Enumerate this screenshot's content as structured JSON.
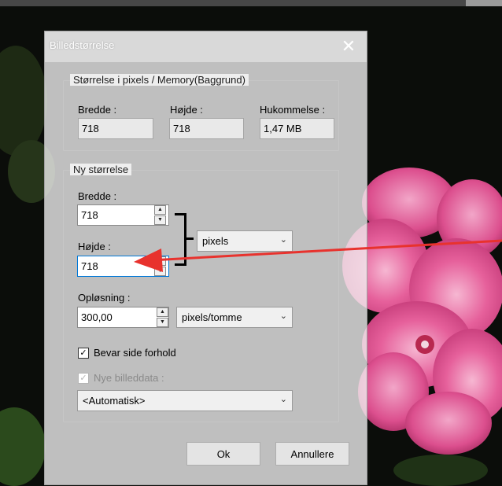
{
  "dialog": {
    "title": "Billedstørrelse",
    "close_glyph": "✕"
  },
  "current_size": {
    "group_label": "Størrelse i pixels / Memory(Baggrund)",
    "width_label": "Bredde :",
    "width_value": "718",
    "height_label": "Højde :",
    "height_value": "718",
    "memory_label": "Hukommelse :",
    "memory_value": "1,47 MB"
  },
  "new_size": {
    "group_label": "Ny størrelse",
    "width_label": "Bredde :",
    "width_value": "718",
    "height_label": "Højde :",
    "height_value": "718",
    "unit_selected": "pixels",
    "resolution_label": "Opløsning :",
    "resolution_value": "300,00",
    "resolution_unit_selected": "pixels/tomme",
    "keep_ratio_label": "Bevar side forhold",
    "keep_ratio_checked": true,
    "new_data_label": "Nye billeddata :",
    "new_data_checked": true,
    "new_data_disabled": true,
    "resample_selected": "<Automatisk>"
  },
  "buttons": {
    "ok": "Ok",
    "cancel": "Annullere"
  },
  "icons": {
    "spin_up": "▲",
    "spin_down": "▼",
    "dropdown": "chevron-down-icon",
    "check": "✓"
  },
  "colors": {
    "annotation_arrow": "#e8322d",
    "focus_border": "#0078d7",
    "flower": "#e0609a"
  }
}
